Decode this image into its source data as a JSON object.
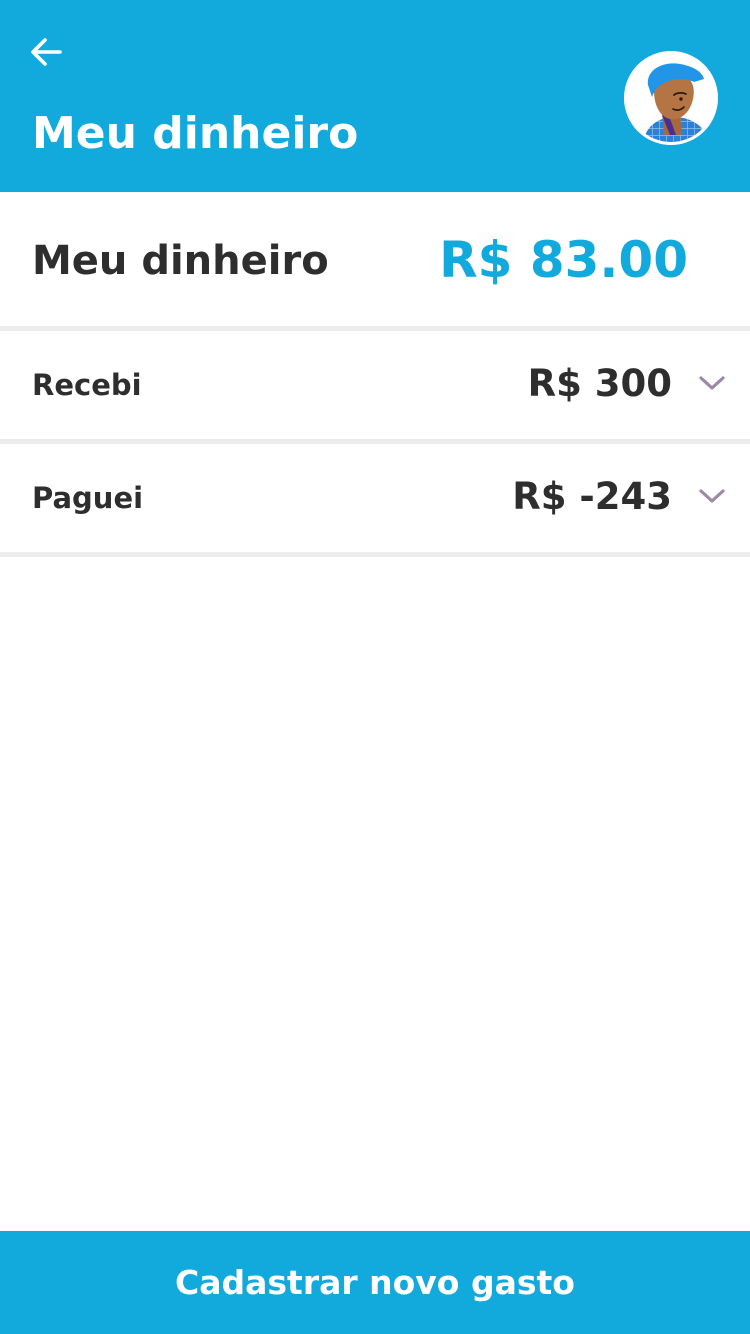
{
  "header": {
    "title": "Meu dinheiro",
    "back_icon": "arrow-left-icon",
    "avatar_icon": "user-avatar-illustration"
  },
  "balance": {
    "label": "Meu dinheiro",
    "value": "R$ 83.00"
  },
  "rows": [
    {
      "label": "Recebi",
      "value": "R$ 300",
      "icon": "chevron-down-icon"
    },
    {
      "label": "Paguei",
      "value": "R$ -243",
      "icon": "chevron-down-icon"
    }
  ],
  "footer": {
    "button_label": "Cadastrar novo gasto"
  },
  "colors": {
    "primary": "#12a9dd",
    "text": "#2e2e2e",
    "divider": "#ececec",
    "chevron": "#9c8aa5"
  }
}
